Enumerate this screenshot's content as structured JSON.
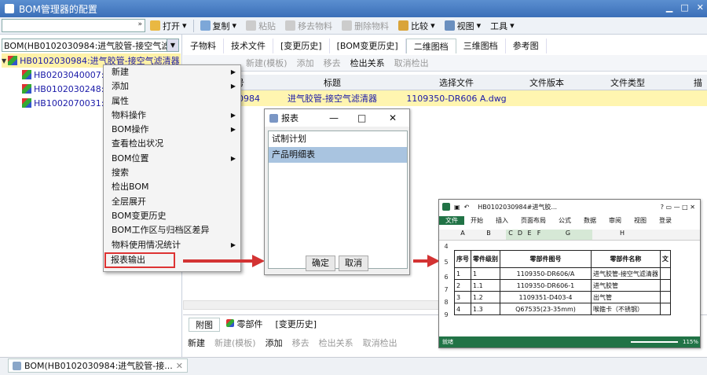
{
  "window": {
    "title": "BOM管理器的配置"
  },
  "toolbar": {
    "open": "打开",
    "copy": "复制",
    "paste": "粘贴",
    "move_out": "移去物料",
    "delete": "删除物料",
    "compare": "比较",
    "view": "视图",
    "tools": "工具"
  },
  "left": {
    "combo_value": "BOM(HB0102030984:进气胶管-接空气滤",
    "tree": [
      {
        "label": "HB0102030984:进气胶管-接空气滤清器"
      },
      {
        "label": "HB0203040007:进"
      },
      {
        "label": "HB0102030248:进"
      },
      {
        "label": "HB1002070031:储"
      }
    ]
  },
  "tabs": [
    "子物料",
    "技术文件",
    "[变更历史]",
    "[BOM变更历史]",
    "二维图档",
    "三维图档",
    "参考图"
  ],
  "subbar": {
    "new_tpl": "新建(模板)",
    "add": "添加",
    "remove": "移去",
    "checkout_rel": "检出关系",
    "cancel_checkout": "取消检出"
  },
  "grid": {
    "headers": [
      "代号",
      "标题",
      "选择文件",
      "文件版本",
      "文件类型",
      "描"
    ],
    "row": {
      "code": "030984",
      "title": "进气胶管-接空气滤清器",
      "file": "1109350-DR606 A.dwg"
    }
  },
  "context_menu": {
    "items": [
      {
        "label": "新建",
        "sub": true
      },
      {
        "label": "添加",
        "sub": true
      },
      {
        "label": "属性",
        "sub": false
      },
      {
        "label": "物料操作",
        "sub": true
      },
      {
        "label": "BOM操作",
        "sub": true
      },
      {
        "label": "查看检出状况",
        "sub": false
      },
      {
        "label": "BOM位置",
        "sub": true
      },
      {
        "label": "搜索",
        "sub": false
      },
      {
        "label": "检出BOM",
        "sub": false
      },
      {
        "label": "全层展开",
        "sub": false
      },
      {
        "label": "BOM变更历史",
        "sub": false
      },
      {
        "label": "BOM工作区与归档区差异",
        "sub": false
      },
      {
        "label": "物料使用情况统计",
        "sub": true
      },
      {
        "label": "报表输出",
        "sub": false
      }
    ]
  },
  "dialog": {
    "title": "报表",
    "items": [
      "试制计划",
      "产品明细表"
    ],
    "ok": "确定",
    "cancel": "取消"
  },
  "bottom": {
    "tabs": [
      "附图",
      "零部件",
      "[变更历史]"
    ],
    "bar": {
      "new": "新建",
      "new_tpl": "新建(模板)",
      "add": "添加",
      "remove": "移去",
      "checkout_rel": "检出关系",
      "cancel_checkout": "取消检出"
    }
  },
  "status": {
    "tab": "BOM(HB0102030984:进气胶管-接..."
  },
  "excel": {
    "title": "HB0102030984#进气胶...",
    "ribbon": [
      "文件",
      "开始",
      "插入",
      "页面布局",
      "公式",
      "数据",
      "审阅",
      "视图",
      "登录"
    ],
    "col_heads": [
      "A",
      "B",
      "C",
      "D",
      "E",
      "F",
      "G",
      "H"
    ],
    "row_nums": [
      "4",
      "5",
      "6",
      "7",
      "8",
      "9"
    ],
    "table_head": [
      "序号",
      "零件级别",
      "零部件图号",
      "零部件名称",
      "文"
    ],
    "rows": [
      [
        "1",
        "1",
        "1109350-DR606/A",
        "进气胶管-接空气滤清器"
      ],
      [
        "2",
        "1.1",
        "1109350-DR606-1",
        "进气胶管"
      ],
      [
        "3",
        "1.2",
        "1109351-D403-4",
        "出气管"
      ],
      [
        "4",
        "1.3",
        "Q67535(23-35mm)",
        "喉箍卡（不锈钢）"
      ]
    ],
    "status": "就绪",
    "zoom": "115%"
  },
  "colors": {
    "accent": "#3b6fb8",
    "highlight_row": "#fff5b0",
    "excel_green": "#217346",
    "arrow_red": "#d33333"
  }
}
